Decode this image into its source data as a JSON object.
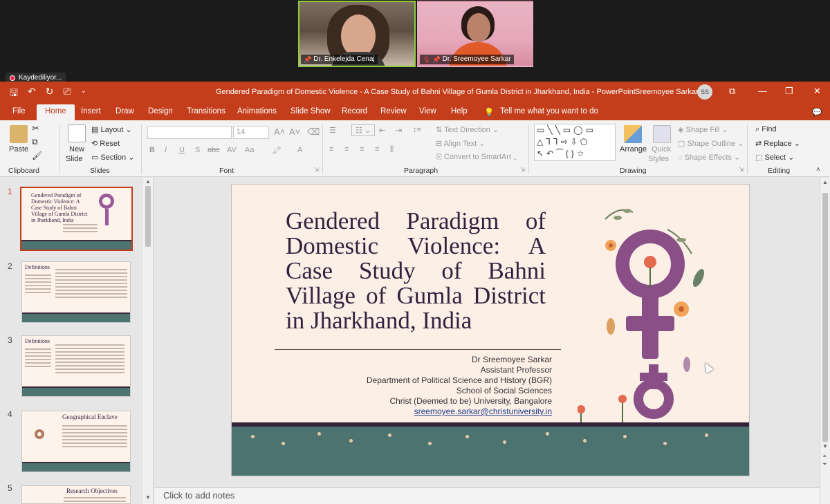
{
  "meeting": {
    "recording_label": "Kaydediliyor...",
    "participants": [
      {
        "name": "Dr. Enkelejda Cenaj"
      },
      {
        "name": "Dr. Sreemoyee Sarkar"
      }
    ]
  },
  "powerpoint": {
    "document_title": "Gendered Paradigm of Domestic Violence - A Case Study of Bahni Village of Gumla District in Jharkhand, India  -  PowerPoint",
    "user_name": "Sreemoyee Sarkar",
    "user_initials": "SS",
    "menu_tabs": [
      "File",
      "Home",
      "Insert",
      "Draw",
      "Design",
      "Transitions",
      "Animations",
      "Slide Show",
      "Record",
      "Review",
      "View",
      "Help"
    ],
    "tell_me": "Tell me what you want to do",
    "ribbon": {
      "clipboard": {
        "paste": "Paste",
        "label": "Clipboard"
      },
      "slides": {
        "new_slide": "New",
        "new_slide2": "Slide",
        "layout": "Layout",
        "reset": "Reset",
        "section": "Section",
        "label": "Slides"
      },
      "font": {
        "size": "14",
        "label": "Font"
      },
      "paragraph": {
        "text_direction": "Text Direction",
        "align_text": "Align Text",
        "convert_smartart": "Convert to SmartArt",
        "label": "Paragraph"
      },
      "drawing": {
        "arrange": "Arrange",
        "quick_styles": "Quick",
        "quick_styles2": "Styles",
        "shape_fill": "Shape Fill",
        "shape_outline": "Shape Outline",
        "shape_effects": "Shape Effects",
        "label": "Drawing"
      },
      "editing": {
        "find": "Find",
        "replace": "Replace",
        "select": "Select",
        "label": "Editing"
      }
    },
    "thumbnails": [
      {
        "num": "1",
        "title": "Gendered Paradigm of Domestic Violence: A Case Study of Bahni Village of Gumla District in Jharkhand, India"
      },
      {
        "num": "2",
        "title": "Definitions"
      },
      {
        "num": "3",
        "title": "Definitions"
      },
      {
        "num": "4",
        "title": "Geographical Enclave"
      },
      {
        "num": "5",
        "title": "Research Objectives"
      }
    ],
    "slide": {
      "title": "Gendered Paradigm of Domestic Violence: A Case Study of Bahni Village of Gumla District in Jharkhand, India",
      "author": "Dr Sreemoyee Sarkar",
      "position": "Assistant Professor",
      "department": "Department of Political Science and History (BGR)",
      "school": "School of Social Sciences",
      "university": "Christ (Deemed to be) University, Bangalore",
      "email": "sreemoyee.sarkar@christuniversity.in"
    },
    "notes_placeholder": "Click to add notes"
  },
  "colors": {
    "ppt_accent": "#c43e1c",
    "slide_bg": "#fcefe6",
    "slide_title": "#34213f",
    "ground": "#4d7370"
  }
}
